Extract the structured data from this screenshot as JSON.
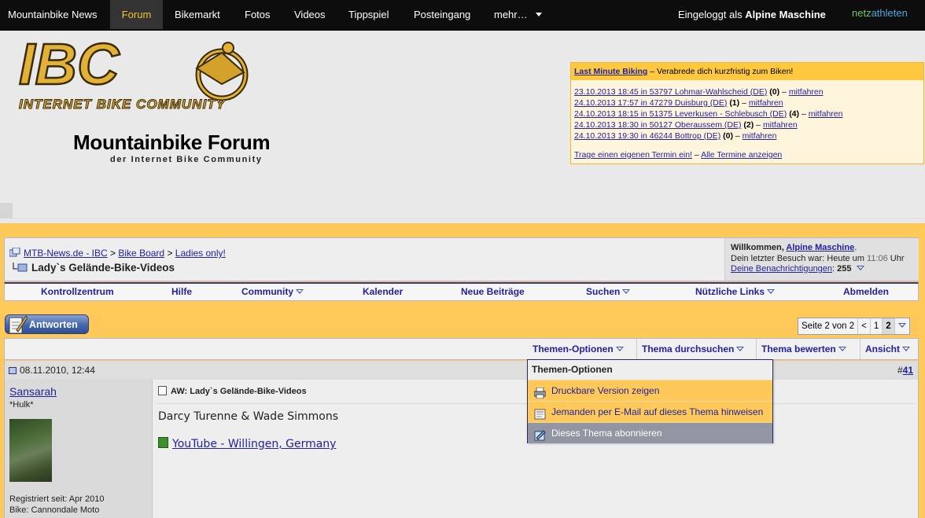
{
  "topnav": {
    "items": [
      "Mountainbike News",
      "Forum",
      "Bikemarkt",
      "Fotos",
      "Videos",
      "Tippspiel",
      "Posteingang",
      "mehr…"
    ],
    "logged_in_prefix": "Eingeloggt als",
    "logged_in_user": "Alpine Maschine",
    "brand_part1": "netz",
    "brand_part2": "athleten"
  },
  "header": {
    "logo_text": "IBC",
    "logo_subtext": "INTERNET BIKE COMMUNITY",
    "title": "Mountainbike Forum",
    "subtitle": "der Internet Bike Community"
  },
  "last_minute": {
    "title_link": "Last Minute Biking",
    "title_rest": " – Verabrede dich kurzfristig zum Biken!",
    "rows": [
      {
        "link": "23.10.2013 18:45 in 53797 Lohmar-Wahlscheid (DE)",
        "count": "(0)",
        "action": "mitfahren"
      },
      {
        "link": "24.10.2013 17:57 in 47279 Duisburg (DE)",
        "count": "(1)",
        "action": "mitfahren"
      },
      {
        "link": "24.10.2013 18:15 in 51375 Leverkusen - Schlebusch (DE)",
        "count": "(4)",
        "action": "mitfahren"
      },
      {
        "link": "24.10.2013 18:30 in 50127 Oberaussem (DE)",
        "count": "(2)",
        "action": "mitfahren"
      },
      {
        "link": "24.10.2013 19:30 in 46244 Bottrop (DE)",
        "count": "(0)",
        "action": "mitfahren"
      }
    ],
    "footer_link1": "Trage einen eigenen Termin ein!",
    "footer_sep": " – ",
    "footer_link2": "Alle Termine anzeigen"
  },
  "breadcrumb": {
    "items": [
      "MTB-News.de - IBC",
      "Bike Board",
      "Ladies only!"
    ],
    "separator": ">",
    "thread_title": "Lady`s Gelände-Bike-Videos"
  },
  "welcome": {
    "greeting": "Willkommen, ",
    "user": "Alpine Maschine",
    "period": ".",
    "last_visit_prefix": "Dein letzter Besuch war: Heute um ",
    "last_visit_time": "11:06",
    "last_visit_suffix": " Uhr",
    "notifications_label": "Deine Benachrichtigungen",
    "notifications_sep": ": ",
    "notifications_count": "255"
  },
  "menubar": {
    "items": [
      "Kontrollzentrum",
      "Hilfe",
      "Community",
      "Kalender",
      "Neue Beiträge",
      "Suchen",
      "Nützliche Links",
      "Abmelden"
    ]
  },
  "reply_button": "Antworten",
  "pager": {
    "label": "Seite 2 von 2",
    "prev": "<",
    "page1": "1",
    "page2": "2"
  },
  "threadtools": {
    "items": [
      "Themen-Optionen",
      "Thema durchsuchen",
      "Thema bewerten",
      "Ansicht"
    ]
  },
  "post": {
    "date": "08.11.2010, 12:44",
    "number_prefix": "#",
    "number": "41",
    "username": "Sansarah",
    "user_title": "*Hulk*",
    "registered": "Registriert seit: Apr 2010",
    "bike": "Bike: Cannondale Moto",
    "title": "AW: Lady`s Gelände-Bike-Videos",
    "text": "Darcy Turenne & Wade Simmons",
    "link": "YouTube - Willingen, Germany"
  },
  "dropdown": {
    "header": "Themen-Optionen",
    "items": [
      {
        "label": "Druckbare Version zeigen",
        "icon": "printer-icon"
      },
      {
        "label": "Jemanden per E-Mail auf dieses Thema hinweisen",
        "icon": "email-icon"
      },
      {
        "label": "Dieses Thema abonnieren",
        "icon": "subscribe-icon"
      }
    ]
  },
  "colors": {
    "accent_gold": "#ffc95a",
    "link_blue": "#22229c",
    "topnav_bg": "#0d0d0d",
    "active_tab_text": "#f4c430"
  }
}
